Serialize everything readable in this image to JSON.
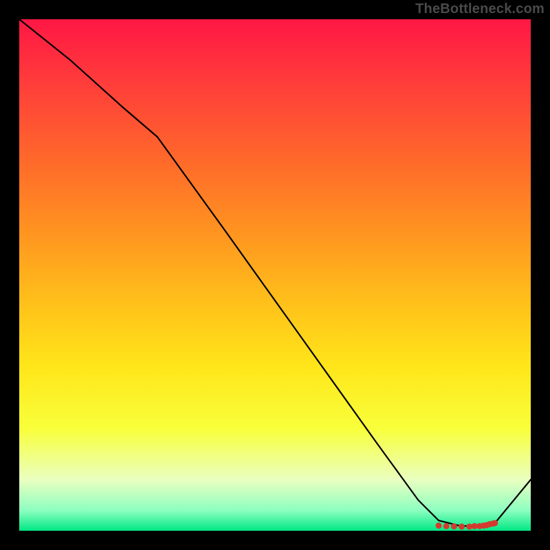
{
  "watermark": "TheBottleneck.com",
  "chart_data": {
    "type": "line",
    "title": "",
    "xlabel": "",
    "ylabel": "",
    "xlim": [
      0,
      100
    ],
    "ylim": [
      0,
      100
    ],
    "grid": false,
    "legend": false,
    "background_gradient": {
      "stops": [
        {
          "offset": 0.0,
          "color": "#ff1744"
        },
        {
          "offset": 0.12,
          "color": "#ff3b3b"
        },
        {
          "offset": 0.28,
          "color": "#ff6a2a"
        },
        {
          "offset": 0.42,
          "color": "#ff9520"
        },
        {
          "offset": 0.55,
          "color": "#ffbf1a"
        },
        {
          "offset": 0.68,
          "color": "#ffe61a"
        },
        {
          "offset": 0.8,
          "color": "#f8ff3a"
        },
        {
          "offset": 0.9,
          "color": "#eaffc0"
        },
        {
          "offset": 0.96,
          "color": "#8dffc0"
        },
        {
          "offset": 1.0,
          "color": "#00e884"
        }
      ]
    },
    "series": [
      {
        "name": "curve",
        "color": "#000000",
        "x": [
          0,
          10,
          20,
          27,
          40,
          55,
          70,
          78,
          82,
          86,
          90,
          93,
          100
        ],
        "values": [
          100,
          92,
          83,
          77,
          59,
          38,
          17,
          6,
          2,
          1,
          0.8,
          1.5,
          10
        ]
      }
    ],
    "markers": {
      "name": "optimum-band",
      "color": "#d43b2f",
      "shape": "circle",
      "x": [
        82,
        83.5,
        85,
        86.5,
        88,
        89,
        90,
        90.8,
        91.4,
        92,
        92.6,
        93
      ],
      "y": [
        1.0,
        0.9,
        0.85,
        0.8,
        0.8,
        0.9,
        0.9,
        1.0,
        1.1,
        1.3,
        1.4,
        1.5
      ]
    }
  }
}
